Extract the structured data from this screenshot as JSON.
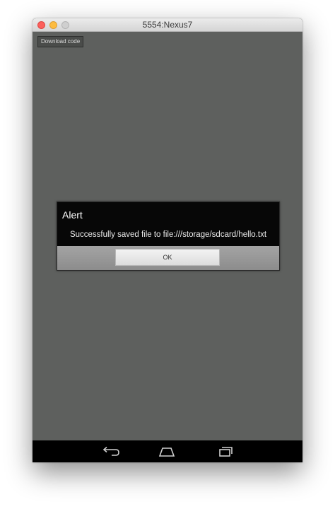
{
  "window": {
    "title": "5554:Nexus7"
  },
  "app": {
    "download_button_label": "Download code"
  },
  "dialog": {
    "title": "Alert",
    "message": "Successfully saved file to file:///storage/sdcard/hello.txt",
    "ok_label": "OK"
  },
  "navbar": {
    "icons": [
      "back-icon",
      "home-icon",
      "recents-icon"
    ]
  },
  "colors": {
    "screen_background": "#5e605e",
    "dialog_background": "#070707",
    "navbar_background": "#000000"
  }
}
